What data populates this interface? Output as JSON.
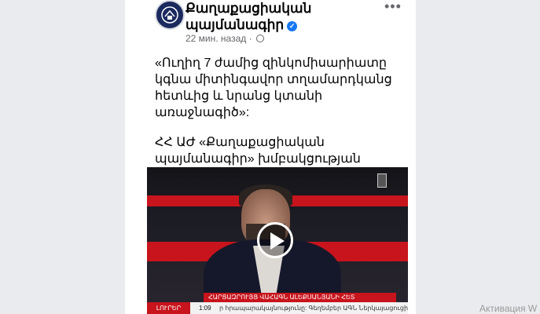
{
  "post": {
    "page_name": "Քաղաքացիական պայմանագիր",
    "time_ago": "22 мин. назад",
    "dot": "·",
    "more_icon": "more-horizontal-icon",
    "paragraph1": "«Ուղիղ 7 ժամից զինկոմիսարիատը կգնա միտինգավոր տղամարդկանց հետևից և նրանց կտանի առաջնագիծ»:",
    "paragraph2": "ՀՀ ԱԺ «Քաղաքացիական պայմանագիր» խմբակցության պատգամավոր Վահագն Ալեքսանյան"
  },
  "video": {
    "lower_third": "ՀԱՐՑԱԶՐՈՒՅՑ ՎԱՀԱԳՆ ԱԼԵՔՍԱՆՅԱՆԻ ՀԵՏ",
    "ticker_label": "ԼՈՒՐԵՐ",
    "ticker_time": "1:09",
    "ticker_text": "ր հրապարակայնությունը: Գեղեմբեր ԱԳՆ Ներկայացուցիչ    Գնալով Վրա",
    "accent_color": "#c8141c"
  },
  "system": {
    "watermark": "Активация W"
  }
}
